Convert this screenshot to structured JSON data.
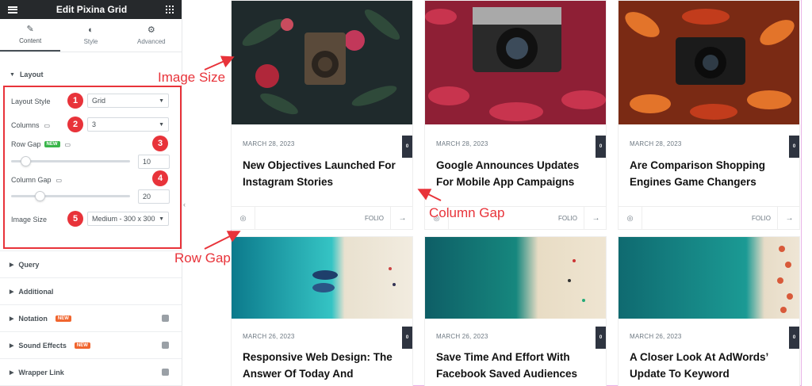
{
  "editor": {
    "title": "Edit Pixina Grid",
    "tabs": [
      {
        "label": "Content",
        "icon": "pencil-icon"
      },
      {
        "label": "Style",
        "icon": "contrast-icon"
      },
      {
        "label": "Advanced",
        "icon": "gear-icon"
      }
    ],
    "layout_section": "Layout",
    "fields": {
      "layout_style": {
        "label": "Layout Style",
        "value": "Grid"
      },
      "columns": {
        "label": "Columns",
        "value": "3"
      },
      "row_gap": {
        "label": "Row Gap",
        "badge": "NEW",
        "value": "10",
        "level": 0.08
      },
      "column_gap": {
        "label": "Column Gap",
        "value": "20",
        "level": 0.2
      },
      "image_size": {
        "label": "Image Size",
        "value": "Medium - 300 x 300"
      }
    },
    "markers": [
      "1",
      "2",
      "3",
      "4",
      "5"
    ],
    "sections": [
      {
        "label": "Query",
        "badge": ""
      },
      {
        "label": "Additional",
        "badge": ""
      },
      {
        "label": "Notation",
        "badge": "NEW"
      },
      {
        "label": "Sound Effects",
        "badge": "NEW"
      },
      {
        "label": "Wrapper Link",
        "badge": ""
      }
    ]
  },
  "cards": [
    {
      "date": "MARCH 28, 2023",
      "title": "New Objectives Launched For Instagram Stories",
      "count": "0",
      "category": "FOLIO",
      "photo": "vintage-camera-roses"
    },
    {
      "date": "MARCH 28, 2023",
      "title": "Google Announces Updates For Mobile App Campaigns",
      "count": "0",
      "category": "FOLIO",
      "photo": "camera-red-leaves"
    },
    {
      "date": "MARCH 28, 2023",
      "title": "Are Comparison Shopping Engines Game Changers",
      "count": "0",
      "category": "FOLIO",
      "photo": "camera-autumn-leaves"
    },
    {
      "date": "MARCH 26, 2023",
      "title": "Responsive Web Design: The Answer Of Today And",
      "count": "0",
      "category": "",
      "photo": "beach-boats"
    },
    {
      "date": "MARCH 26, 2023",
      "title": "Save Time And Effort With Facebook Saved Audiences",
      "count": "0",
      "category": "",
      "photo": "beach-aerial"
    },
    {
      "date": "MARCH 26, 2023",
      "title": "A Closer Look At AdWords’ Update To Keyword",
      "count": "0",
      "category": "",
      "photo": "beach-umbrellas"
    }
  ],
  "annotations": {
    "image_size": "Image Size",
    "column_gap": "Column Gap",
    "row_gap": "Row Gap"
  },
  "colors": {
    "accent_red": "#e8333a",
    "topbar": "#26292c",
    "outline": "#e9b3e7"
  }
}
